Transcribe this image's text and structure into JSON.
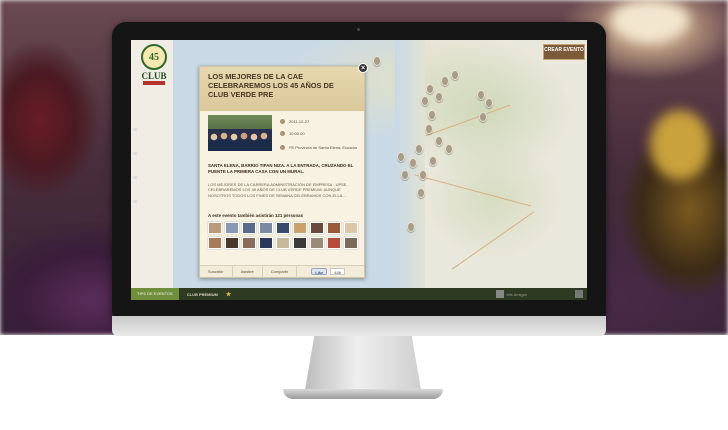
{
  "popup": {
    "title": "LOS MEJORES DE LA CAE CELEBRAREMOS LOS 45 AÑOS DE CLUB VERDE PRE",
    "date": "2011-12-27",
    "time": "10:00:00",
    "location": "FE Provincia de Santa Elena, Ecuador",
    "subtitle": "SANTA ELENA, BARRIO TIPAN NIZA. A LA ENTRADA, CRUZANDO EL PUENTE LA PRIMERA CASA CON UN MURAL.",
    "description": "LOS MEJORES DE LA CARRERA ADMINISTRACIÓN DE EMPRESA - UPSE, CELEBRAREMOS LOS 45 AÑOS DE CLUB VERDE PREMIUM. AUNQUE NOSOTROS TODOS LOS FINES DE SEMANA CELEBRAMOS CON ELLA...",
    "attendees_label": "A este evento también asistirán 121 personas",
    "footer": {
      "subscribe": "Suscribir",
      "attend": "Asistiré",
      "share": "Compartir",
      "like": "Like",
      "like_count": "486"
    },
    "close": "×"
  },
  "map": {
    "create_event": "CREAR EVENTO"
  },
  "logo": {
    "number": "45",
    "text": "CLUB"
  },
  "bottombar": {
    "tab_active": "TIPS DE EVENTOS",
    "tab_club": "CLUB PREMIUM",
    "user_name": "Mis Amigos"
  },
  "colors": {
    "accent": "#6f8f3a",
    "popup_header": "#d9c89a",
    "brand_red": "#b8322c"
  }
}
